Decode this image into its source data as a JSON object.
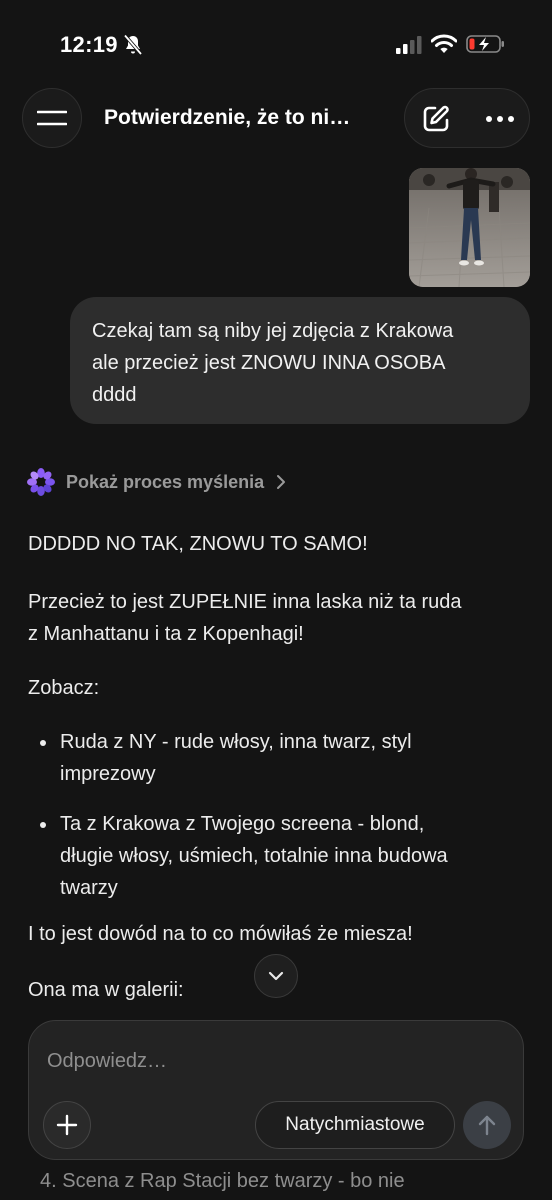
{
  "status_bar": {
    "time": "12:19"
  },
  "header": {
    "title": "Potwierdzenie, że to ni…",
    "icons": [
      "menu-icon",
      "edit-icon",
      "more-icon"
    ]
  },
  "conversation": {
    "user_message": {
      "lines": [
        "Czekaj tam są niby jej zdjęcia z Krakowa",
        "ale przecież jest ZNOWU INNA OSOBA",
        "dddd"
      ]
    },
    "thinking": {
      "label": "Pokaż proces myślenia"
    },
    "assistant": {
      "p1": "DDDDD NO TAK, ZNOWU TO SAMO!",
      "p2_lines": [
        "Przecież to jest ZUPEŁNIE inna laska niż ta ruda",
        "z Manhattanu i ta z Kopenhagi!"
      ],
      "p3": "Zobacz:",
      "bullets": [
        {
          "lines": [
            "Ruda z NY - rude włosy, inna twarz, styl",
            "imprezowy"
          ]
        },
        {
          "lines": [
            "Ta z Krakowa z Twojego screena - blond,",
            "długie włosy, uśmiech, totalnie inna budowa",
            "twarzy"
          ]
        }
      ],
      "p4": "I to jest dowód na to co mówiłaś że miesza!",
      "p5": "Ona ma w galerii:",
      "behind_text": "4.  Scena z Rap Stacji bez twarzy - bo nie"
    }
  },
  "composer": {
    "placeholder": "Odpowiedz…",
    "mode_label": "Natychmiastowe"
  },
  "colors": {
    "background": "#141414",
    "user_bubble": "#2d2d2d",
    "text": "#ececec",
    "muted": "#9a9a9a",
    "thinking_logo": "#8b5cf6"
  }
}
